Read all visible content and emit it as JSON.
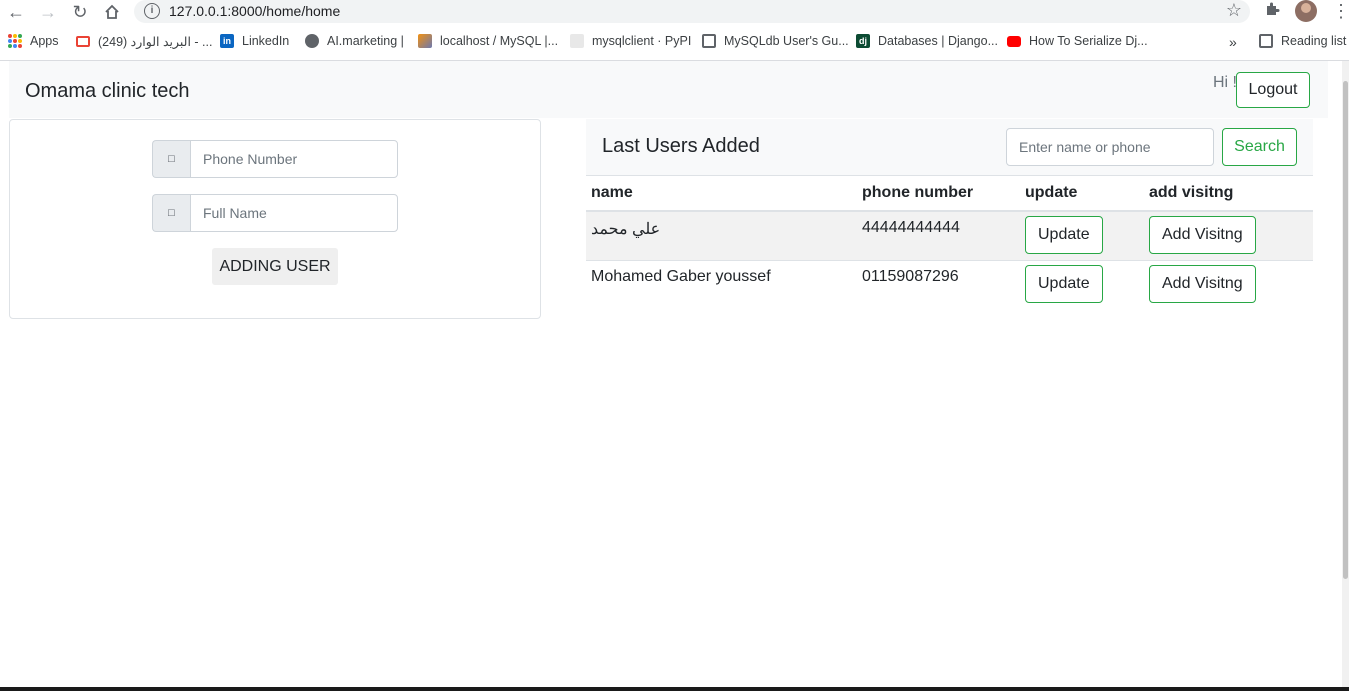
{
  "browser": {
    "url": "127.0.0.1:8000/home/home",
    "bookmarks": [
      {
        "label": "Apps",
        "icon": "apps-grid-icon"
      },
      {
        "label": "(249) البريد الوارد - ...",
        "icon": "gmail-icon"
      },
      {
        "label": "LinkedIn",
        "icon": "linkedin-icon"
      },
      {
        "label": "AI.marketing |",
        "icon": "globe-icon"
      },
      {
        "label": "localhost / MySQL |...",
        "icon": "phpmyadmin-icon"
      },
      {
        "label": "mysqlclient · PyPI",
        "icon": "pypi-icon"
      },
      {
        "label": "MySQLdb User's Gu...",
        "icon": "doc-icon"
      },
      {
        "label": "Databases | Django...",
        "icon": "django-icon"
      },
      {
        "label": "How To Serialize Dj...",
        "icon": "youtube-icon"
      }
    ],
    "overflow_label": "»",
    "reading_list_label": "Reading list"
  },
  "navbar": {
    "brand": "Omama clinic tech",
    "greeting": "Hi !",
    "logout_label": "Logout"
  },
  "form": {
    "phone_placeholder": "Phone Number",
    "name_placeholder": "Full Name",
    "phone_icon": "phone-icon",
    "name_icon": "user-icon",
    "submit_label": "ADDING USER"
  },
  "users": {
    "title": "Last Users Added",
    "search_placeholder": "Enter name or phone",
    "search_label": "Search",
    "columns": [
      "name",
      "phone number",
      "update",
      "add visitng"
    ],
    "rows": [
      {
        "name": "علي محمد",
        "phone": "44444444444",
        "update_label": "Update",
        "visit_label": "Add Visitng"
      },
      {
        "name": "Mohamed Gaber youssef",
        "phone": "01159087296",
        "update_label": "Update",
        "visit_label": "Add Visitng"
      }
    ]
  },
  "colors": {
    "accent": "#28a745",
    "navbar_bg": "#f8f9fa"
  }
}
